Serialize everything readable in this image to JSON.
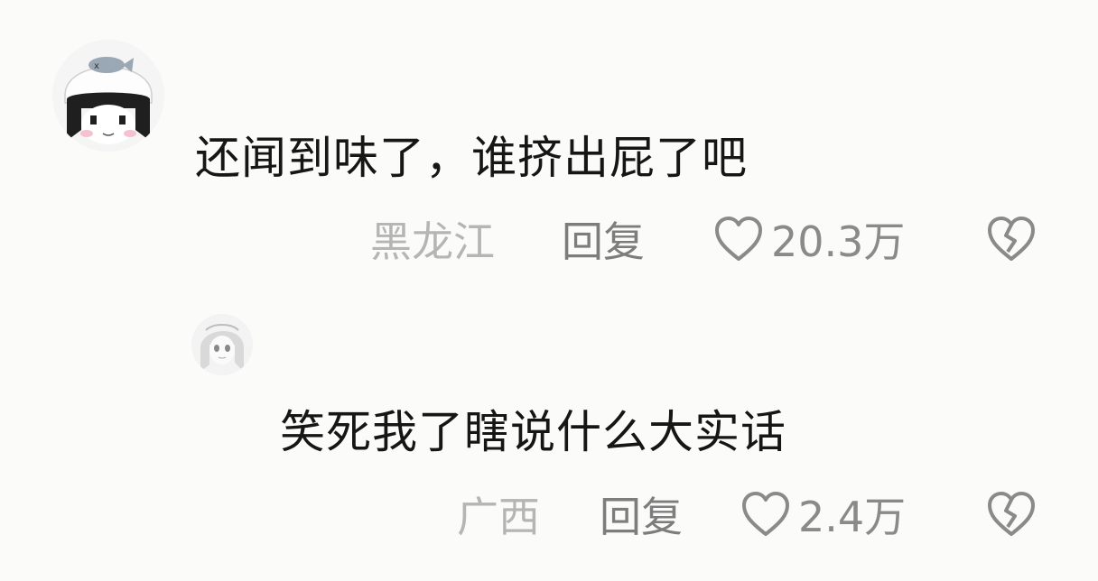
{
  "comments": [
    {
      "text": "还闻到味了，谁挤出屁了吧",
      "location": "黑龙江",
      "reply_label": "回复",
      "likes": "20.3万",
      "avatar_icon": "chibi-girl-fish-hat-avatar"
    },
    {
      "text": "笑死我了瞎说什么大实话",
      "location": "广西",
      "reply_label": "回复",
      "likes": "2.4万",
      "avatar_icon": "anime-girl-avatar"
    }
  ],
  "icons": {
    "like": "heart-outline-icon",
    "dislike": "broken-heart-icon"
  },
  "colors": {
    "background": "#fbfbfa",
    "text": "#161616",
    "location": "#b5b5b5",
    "reply": "#7d7d7d",
    "like": "#8a8a8a"
  }
}
